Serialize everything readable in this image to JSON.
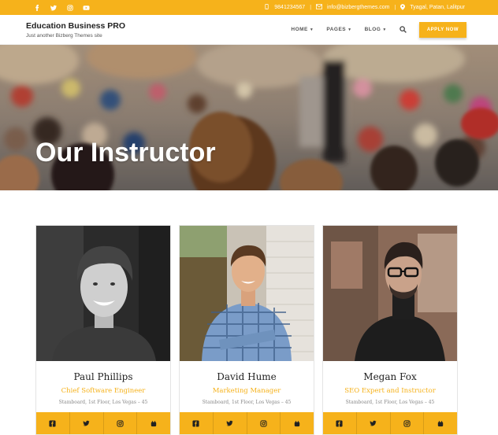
{
  "topbar": {
    "social": [
      "facebook-icon",
      "twitter-icon",
      "instagram-icon",
      "youtube-icon"
    ],
    "phone": "9841234567",
    "email": "info@bizbergthemes.com",
    "location": "Tyagal, Patan, Lalitpur",
    "separator": "|"
  },
  "header": {
    "title": "Education Business PRO",
    "tagline": "Just another Bizberg Themes site",
    "nav": [
      {
        "label": "HOME",
        "has_dropdown": true
      },
      {
        "label": "PAGES",
        "has_dropdown": true
      },
      {
        "label": "BLOG",
        "has_dropdown": true
      }
    ],
    "apply_label": "APPLY NOW"
  },
  "hero": {
    "title": "Our Instructor"
  },
  "instructors": [
    {
      "name": "Paul Phillips",
      "role": "Chief Software Engineer",
      "address": "Stamboard, 1st Floor, Los Vegas – 45"
    },
    {
      "name": "David Hume",
      "role": "Marketing Manager",
      "address": "Stamboard, 1st Floor, Los Vegas – 45"
    },
    {
      "name": "Megan Fox",
      "role": "SEO Expert and Instructor",
      "address": "Stamboard, 1st Floor, Los Vegas – 45"
    }
  ],
  "card_social": [
    "facebook-icon",
    "twitter-icon",
    "instagram-icon",
    "youtube-icon"
  ],
  "colors": {
    "accent": "#f6b21b",
    "text": "#222222",
    "muted": "#888888"
  }
}
